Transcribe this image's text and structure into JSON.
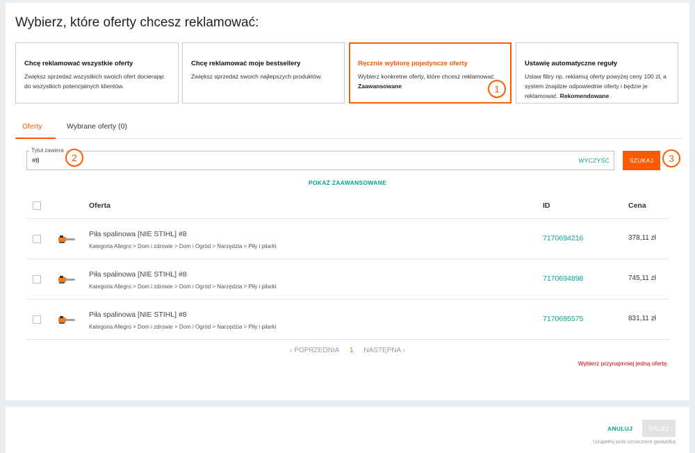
{
  "page": {
    "title": "Wybierz, które oferty chcesz reklamować:"
  },
  "cards": [
    {
      "title": "Chcę reklamować wszystkie oferty",
      "desc": "Zwiększ sprzedaż wszystkich swoich ofert docierając do wszystkich potencjalnych klientów.",
      "tag": ""
    },
    {
      "title": "Chcę reklamować moje bestsellery",
      "desc": "Zwiększ sprzedaż swoich najlepszych produktów.",
      "tag": ""
    },
    {
      "title": "Ręcznie wybiorę pojedyncze oferty",
      "desc": "Wybierz konkretne oferty, które chcesz reklamować.",
      "tag": "Zaawansowane"
    },
    {
      "title": "Ustawię automatyczne reguły",
      "desc": "Ustaw filtry np. reklamuj oferty powyżej ceny 100 zł, a system znajdzie odpowiednie oferty i będzie je reklamować.",
      "tag": "Rekomendowane"
    }
  ],
  "badges": [
    "1",
    "2",
    "3"
  ],
  "tabs": [
    {
      "label": "Oferty"
    },
    {
      "label": "Wybrane oferty (0)"
    }
  ],
  "search": {
    "label": "Tytuł zawiera",
    "value": "#8",
    "clear_label": "WYCZYŚĆ",
    "button_label": "SZUKAJ"
  },
  "advanced_label": "POKAŻ ZAAWANSOWANE",
  "table": {
    "headers": {
      "offer": "Oferta",
      "id": "ID",
      "price": "Cena"
    },
    "rows": [
      {
        "title": "Piła spalinowa [NIE STIHL] #8",
        "category": "Kategoria Allegro > Dom i zdrowie > Dom i Ogród > Narzędzia > Piły i pilarki",
        "id": "7170694216",
        "price": "378,11 zł"
      },
      {
        "title": "Piła spalinowa [NIE STIHL] #8",
        "category": "Kategoria Allegro > Dom i zdrowie > Dom i Ogród > Narzędzia > Piły i pilarki",
        "id": "7170694898",
        "price": "745,11 zł"
      },
      {
        "title": "Piła spalinowa [NIE STIHL] #8",
        "category": "Kategoria Allegro > Dom i zdrowie > Dom i Ogród > Narzędzia > Piły i pilarki",
        "id": "7170695575",
        "price": "831,11 zł"
      }
    ]
  },
  "pagination": {
    "prev": "‹ POPRZEDNIA",
    "current": "1",
    "next": "NASTĘPNA ›"
  },
  "error": "Wybierz przynajmniej jedną ofertę.",
  "footer": {
    "cancel": "ANULUJ",
    "next": "DALEJ",
    "hint": "Uzupełnij pola oznaczone gwiazdką"
  },
  "colors": {
    "accent": "#ff5a00",
    "link": "#00a790",
    "error": "#d20000"
  }
}
